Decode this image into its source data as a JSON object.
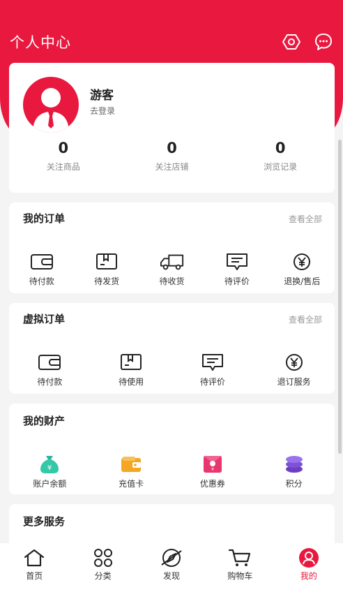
{
  "header": {
    "title": "个人中心",
    "icons": [
      "gear-icon",
      "message-icon"
    ]
  },
  "profile": {
    "name": "游客",
    "login_label": "去登录"
  },
  "stats": [
    {
      "value": "0",
      "label": "关注商品"
    },
    {
      "value": "0",
      "label": "关注店铺"
    },
    {
      "value": "0",
      "label": "浏览记录"
    }
  ],
  "orders": {
    "title": "我的订单",
    "more": "查看全部",
    "items": [
      {
        "label": "待付款",
        "icon": "wallet-icon"
      },
      {
        "label": "待发货",
        "icon": "box-icon"
      },
      {
        "label": "待收货",
        "icon": "truck-icon"
      },
      {
        "label": "待评价",
        "icon": "comment-icon"
      },
      {
        "label": "退换/售后",
        "icon": "yen-icon"
      }
    ]
  },
  "virtual_orders": {
    "title": "虚拟订单",
    "more": "查看全部",
    "items": [
      {
        "label": "待付款",
        "icon": "wallet-icon"
      },
      {
        "label": "待使用",
        "icon": "box-icon"
      },
      {
        "label": "待评价",
        "icon": "comment-icon"
      },
      {
        "label": "退订服务",
        "icon": "yen-icon"
      }
    ]
  },
  "assets": {
    "title": "我的财产",
    "items": [
      {
        "label": "账户余额",
        "icon": "money-bag-icon"
      },
      {
        "label": "充值卡",
        "icon": "card-wallet-icon"
      },
      {
        "label": "优惠券",
        "icon": "coupon-icon"
      },
      {
        "label": "积分",
        "icon": "coins-icon"
      }
    ]
  },
  "more_services": {
    "title": "更多服务"
  },
  "tabbar": [
    {
      "label": "首页",
      "icon": "home-icon"
    },
    {
      "label": "分类",
      "icon": "grid-icon"
    },
    {
      "label": "发现",
      "icon": "compass-icon"
    },
    {
      "label": "购物车",
      "icon": "cart-icon"
    },
    {
      "label": "我的",
      "icon": "user-icon"
    }
  ],
  "colors": {
    "brand": "#e8183f",
    "background": "#f4f4f4"
  }
}
